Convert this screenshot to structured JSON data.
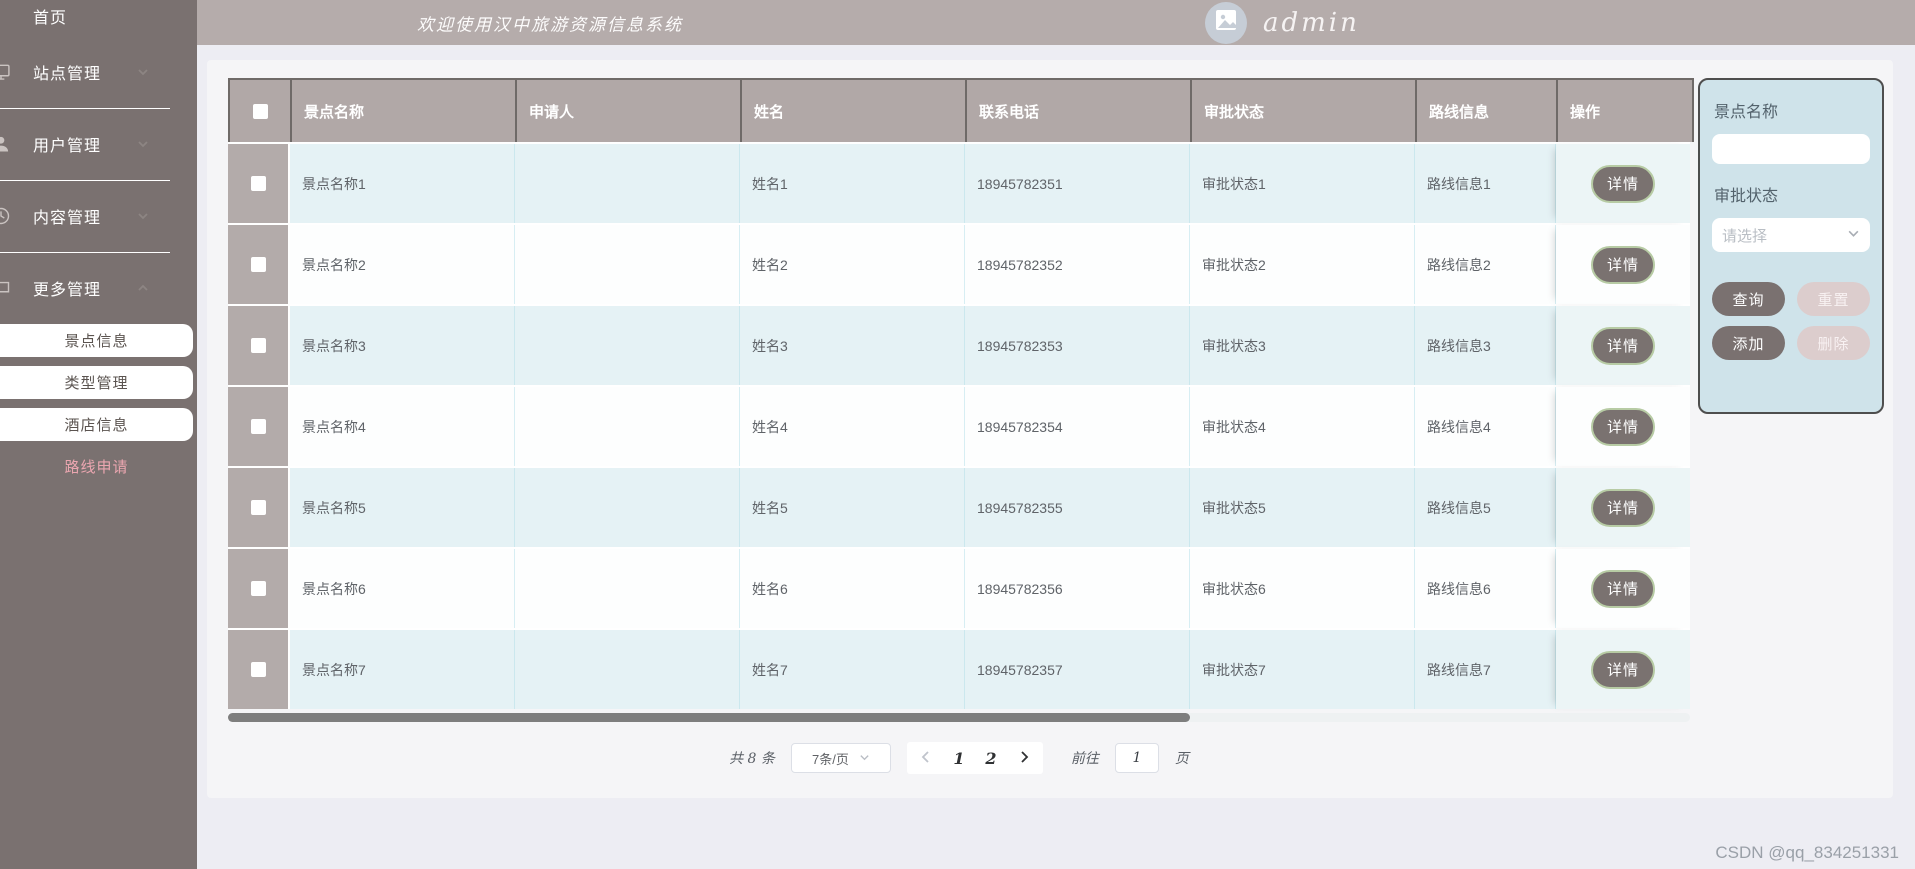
{
  "sidebar": {
    "items": [
      {
        "label": "首页",
        "icon": null,
        "chevron": null
      },
      {
        "label": "站点管理",
        "icon": "monitor-icon",
        "chevron": "down"
      },
      {
        "label": "用户管理",
        "icon": "user-icon",
        "chevron": "down"
      },
      {
        "label": "内容管理",
        "icon": "clock-icon",
        "chevron": "down"
      },
      {
        "label": "更多管理",
        "icon": "chat-icon",
        "chevron": "up"
      }
    ],
    "submenu": [
      {
        "label": "景点信息",
        "active": false
      },
      {
        "label": "类型管理",
        "active": false
      },
      {
        "label": "酒店信息",
        "active": false
      },
      {
        "label": "路线申请",
        "active": true
      }
    ],
    "active_color": "#eba6b0"
  },
  "header": {
    "welcome": "欢迎使用汉中旅游资源信息系统",
    "username": "admin",
    "avatar_icon": "image-icon"
  },
  "table": {
    "columns": [
      "景点名称",
      "申请人",
      "姓名",
      "联系电话",
      "审批状态",
      "路线信息",
      "操作"
    ],
    "rows": [
      [
        "景点名称1",
        "",
        "姓名1",
        "18945782351",
        "审批状态1",
        "路线信息1"
      ],
      [
        "景点名称2",
        "",
        "姓名2",
        "18945782352",
        "审批状态2",
        "路线信息2"
      ],
      [
        "景点名称3",
        "",
        "姓名3",
        "18945782353",
        "审批状态3",
        "路线信息3"
      ],
      [
        "景点名称4",
        "",
        "姓名4",
        "18945782354",
        "审批状态4",
        "路线信息4"
      ],
      [
        "景点名称5",
        "",
        "姓名5",
        "18945782355",
        "审批状态5",
        "路线信息5"
      ],
      [
        "景点名称6",
        "",
        "姓名6",
        "18945782356",
        "审批状态6",
        "路线信息6"
      ],
      [
        "景点名称7",
        "",
        "姓名7",
        "18945782357",
        "审批状态7",
        "路线信息7"
      ]
    ],
    "action_label": "详情"
  },
  "pagination": {
    "total_text": "共 8 条",
    "page_size": "7条/页",
    "pages": [
      "1",
      "2"
    ],
    "current_page": "1",
    "goto_label": "前往",
    "goto_value": "1",
    "page_label": "页"
  },
  "filter_panel": {
    "name_label": "景点名称",
    "name_value": "",
    "status_label": "审批状态",
    "status_placeholder": "请选择",
    "buttons": [
      {
        "label": "查询",
        "style": "dark"
      },
      {
        "label": "重置",
        "style": "light"
      },
      {
        "label": "添加",
        "style": "dark"
      },
      {
        "label": "删除",
        "style": "light"
      }
    ]
  },
  "watermark": "CSDN @qq_834251331",
  "colors": {
    "sidebar_bg": "#7a7170",
    "header_bg": "#b5acab",
    "table_header_bg": "#b1a8a7",
    "row_alt_bg": "#e5f2f5",
    "panel_bg": "#cfe3ea",
    "button_dark": "#7a7170",
    "button_light": "#dccdcd",
    "detail_button_border": "#b7cba4",
    "active_menu_text": "#eba6b0"
  }
}
